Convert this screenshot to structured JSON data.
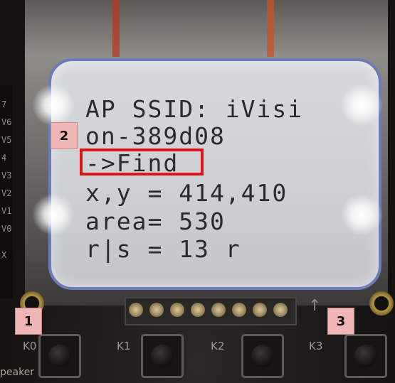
{
  "lcd": {
    "lines": [
      "AP SSID: iVisi",
      "on-389d08",
      "->Find",
      "x,y = 414,410",
      "area= 530",
      "r|s = 13 r"
    ],
    "highlighted_line_index": 2
  },
  "annotations": [
    {
      "label": "1",
      "target": "K0 key"
    },
    {
      "label": "2",
      "target": "->Find menu line"
    },
    {
      "label": "3",
      "target": "K3 key"
    }
  ],
  "keys": [
    {
      "label": "K0"
    },
    {
      "label": "K1"
    },
    {
      "label": "K2"
    },
    {
      "label": "K3"
    }
  ],
  "board_side_text": [
    "7",
    "V6",
    "V5",
    "4",
    "V3",
    "V2",
    "V1",
    "V0",
    "X"
  ],
  "board_bottom_text": "peaker",
  "colors": {
    "highlight": "#e01616",
    "badge": "#f0b6b6",
    "lcd_bg": "#cdd1d4",
    "lcd_text": "#2b2b2d"
  }
}
